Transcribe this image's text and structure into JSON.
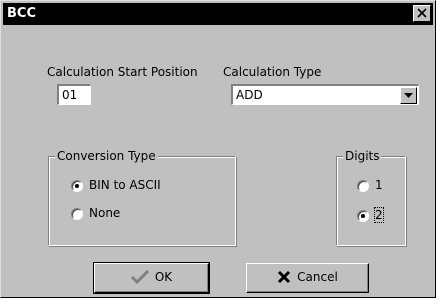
{
  "window": {
    "title": "BCC",
    "close_icon": "close-x-icon"
  },
  "calc_start": {
    "label": "Calculation Start Position",
    "value": "01"
  },
  "calc_type": {
    "label": "Calculation Type",
    "selected": "ADD",
    "arrow_icon": "chevron-down-icon"
  },
  "conversion": {
    "title": "Conversion Type",
    "options": [
      {
        "label": "BIN to ASCII",
        "checked": true
      },
      {
        "label": "None",
        "checked": false
      }
    ]
  },
  "digits": {
    "title": "Digits",
    "options": [
      {
        "label": "1",
        "checked": false
      },
      {
        "label": "2",
        "checked": true
      }
    ]
  },
  "buttons": {
    "ok": {
      "label": "OK",
      "icon": "checkmark-icon",
      "icon_color": "#808080"
    },
    "cancel": {
      "label": "Cancel",
      "icon": "x-mark-icon",
      "icon_color": "#000000"
    }
  },
  "colors": {
    "face": "#c0c0c0",
    "titlebar": "#000000",
    "title_text": "#ffffff"
  }
}
